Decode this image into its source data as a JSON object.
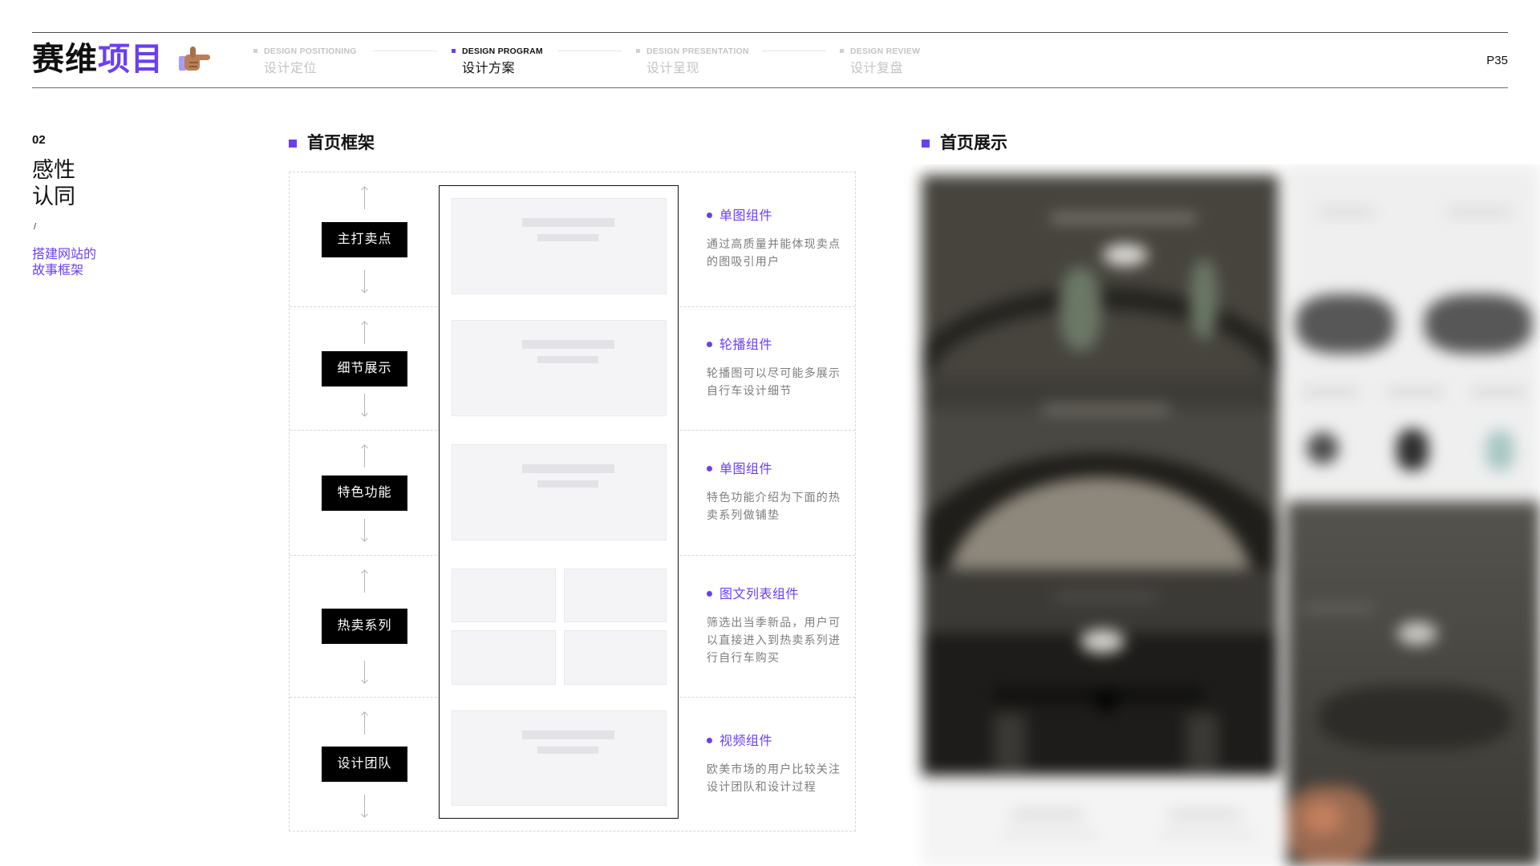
{
  "header": {
    "logo": {
      "part1": "赛维",
      "part2": "项目",
      "icon": "pointing-hand-icon"
    },
    "steps": [
      {
        "en": "DESIGN POSITIONING",
        "zh": "设计定位"
      },
      {
        "en": "DESIGN PROGRAM",
        "zh": "设计方案"
      },
      {
        "en": "DESIGN PRESENTATION",
        "zh": "设计呈现"
      },
      {
        "en": "DESIGN REVIEW",
        "zh": "设计复盘"
      }
    ],
    "active_step": 1,
    "page_number": "P35"
  },
  "section": {
    "index": "02",
    "title_lines": [
      "感性",
      "认同"
    ],
    "divider": "/",
    "subtitle_lines": [
      "搭建网站的",
      "故事框架"
    ]
  },
  "framework": {
    "heading": "首页框架",
    "rows": [
      {
        "label": "主打卖点",
        "component": "单图组件",
        "desc_lines": [
          "通过高质量并能体现卖点",
          "的图吸引用户"
        ]
      },
      {
        "label": "细节展示",
        "component": "轮播组件",
        "desc_lines": [
          "轮播图可以尽可能多展示",
          "自行车设计细节"
        ]
      },
      {
        "label": "特色功能",
        "component": "单图组件",
        "desc_lines": [
          "特色功能介绍为下面的热",
          "卖系列做铺垫"
        ]
      },
      {
        "label": "热卖系列",
        "component": "图文列表组件",
        "desc_lines": [
          "筛选出当季新品，用户可",
          "以直接进入到热卖系列进",
          "行自行车购买"
        ]
      },
      {
        "label": "设计团队",
        "component": "视频组件",
        "desc_lines": [
          "欧美市场的用户比较关注",
          "设计团队和设计过程"
        ]
      }
    ]
  },
  "showcase": {
    "heading": "首页展示"
  },
  "colors": {
    "accent": "#6b3ff0",
    "label_bg": "#000000",
    "muted_text": "#7d7d7d",
    "inactive_step": "#c4c4c4",
    "wireframe_fill": "#f4f4f7"
  }
}
